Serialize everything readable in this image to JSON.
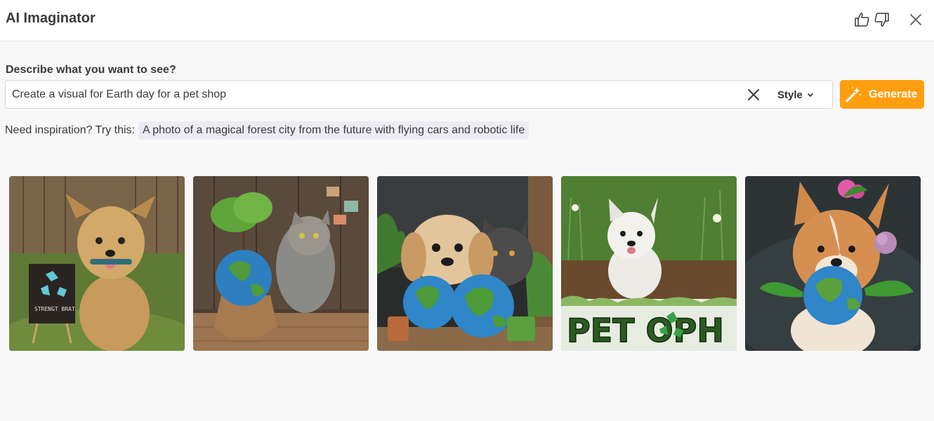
{
  "header": {
    "title": "AI Imaginator",
    "thumbs_up_icon": "thumbs-up-icon",
    "thumbs_down_icon": "thumbs-down-icon",
    "close_icon": "close-icon"
  },
  "prompt": {
    "label": "Describe what you want to see?",
    "value": "Create a visual for Earth day for a pet shop",
    "clear_icon": "close-icon",
    "style_label": "Style",
    "style_icon": "chevron-down-icon"
  },
  "generate": {
    "label": "Generate",
    "icon": "magic-wand-icon",
    "color": "#ff9f0f"
  },
  "inspiration": {
    "lead": "Need inspiration? Try this:",
    "suggestion": "A photo of a magical forest city from the future with flying cars and robotic life"
  },
  "results": [
    {
      "subject": "yorkie-dog",
      "sign_text": "STRENGT BRAT"
    },
    {
      "subject": "tabby-cat-with-globe-and-tree"
    },
    {
      "subject": "pekingese-and-grey-cat-with-globes"
    },
    {
      "subject": "white-terrier-puppy",
      "banner_text": "PET OPH"
    },
    {
      "subject": "corgi-with-flower-and-globe"
    }
  ]
}
